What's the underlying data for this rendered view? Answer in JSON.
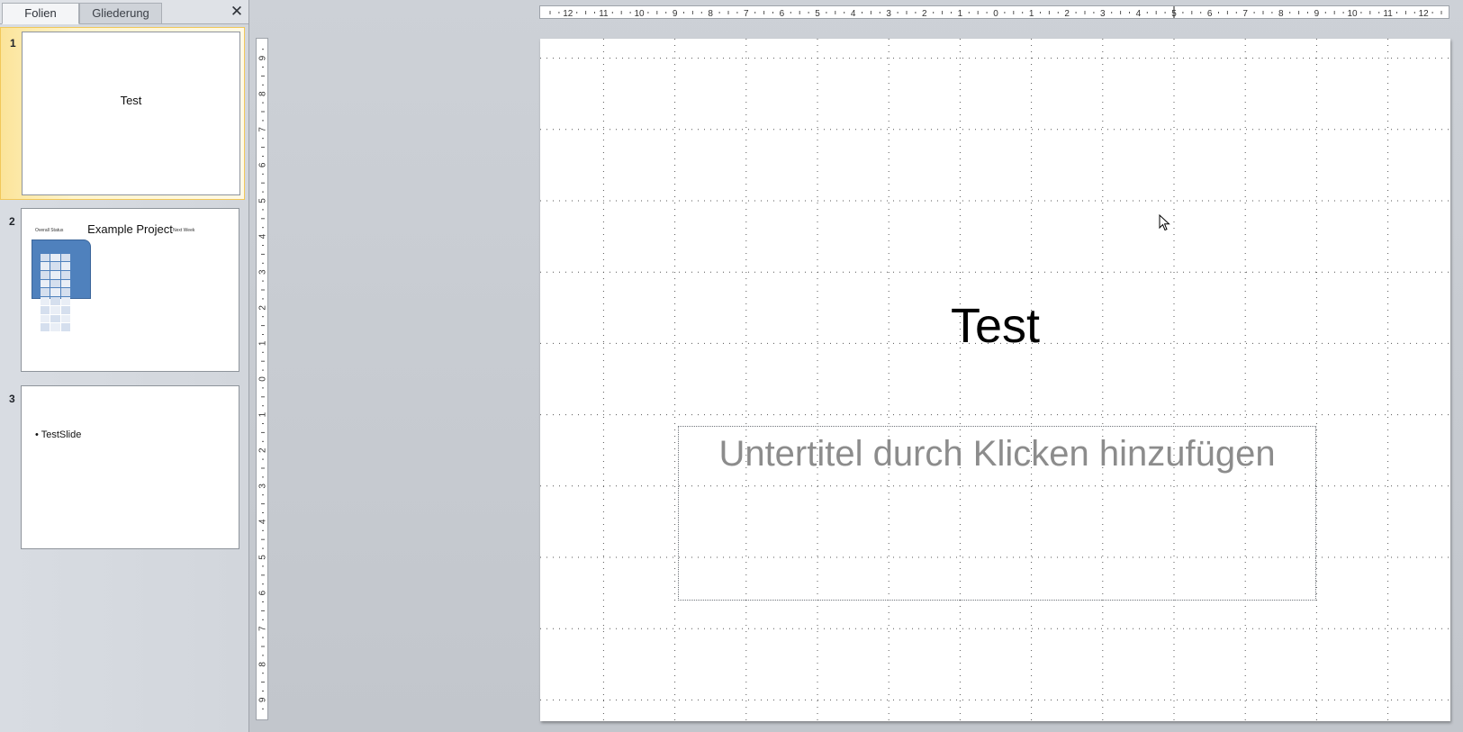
{
  "panel": {
    "tabs": [
      {
        "label": "Folien",
        "active": true
      },
      {
        "label": "Gliederung",
        "active": false
      }
    ],
    "close_icon": "close-icon"
  },
  "thumbnails": [
    {
      "number": "1",
      "title": "Test",
      "selected": true
    },
    {
      "number": "2",
      "title": "Example Project",
      "left_caption": "Overall Status",
      "right_caption": "Next Week"
    },
    {
      "number": "3",
      "bullet": "• TestSlide"
    }
  ],
  "slide": {
    "title": "Test",
    "subtitle_placeholder": "Untertitel durch Klicken hinzufügen"
  },
  "rulers": {
    "horizontal_labels": [
      "12",
      "11",
      "10",
      "9",
      "8",
      "7",
      "6",
      "5",
      "4",
      "3",
      "2",
      "1",
      "0",
      "1",
      "2",
      "3",
      "4",
      "5",
      "6",
      "7",
      "8",
      "9",
      "10",
      "11",
      "12"
    ],
    "vertical_labels": [
      "9",
      "8",
      "7",
      "6",
      "5",
      "4",
      "3",
      "2",
      "1",
      "0",
      "1",
      "2",
      "3",
      "4",
      "5",
      "6",
      "7",
      "8",
      "9"
    ]
  },
  "colors": {
    "selection_highlight": "#fbe49a",
    "shape_blue": "#4f81bd",
    "placeholder_gray": "#8c8c8c"
  }
}
